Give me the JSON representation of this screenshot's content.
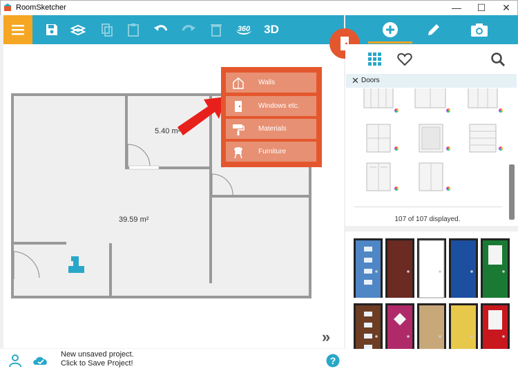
{
  "window": {
    "title": "RoomSketcher",
    "minimize": "—",
    "maximize": "☐",
    "close": "✕"
  },
  "toolbar": {
    "tools": [
      "menu-icon",
      "save-icon",
      "layers-icon",
      "copy-icon",
      "paste-icon",
      "undo-icon",
      "redo-icon",
      "delete-icon",
      "view-360-icon",
      "view-3d-icon"
    ],
    "label_360": "360",
    "label_3d": "3D"
  },
  "plan": {
    "room_small_area": "5.40 m²",
    "room_large_area": "39.59 m²"
  },
  "popup_menu": {
    "items": [
      {
        "label": "Walls",
        "icon": "house-icon"
      },
      {
        "label": "Windows etc.",
        "icon": "door-icon"
      },
      {
        "label": "Materials",
        "icon": "paint-roller-icon"
      },
      {
        "label": "Furniture",
        "icon": "chair-icon"
      }
    ]
  },
  "right_panel": {
    "tabs": [
      "add-icon",
      "edit-icon",
      "camera-icon"
    ],
    "subtabs": [
      "grid-icon",
      "heart-icon",
      "search-icon"
    ],
    "filter_label": "Doors",
    "count_text": "107 of 107 displayed."
  },
  "door_colors": [
    "#4f86c6",
    "#6b2a22",
    "#ffffff",
    "#1d4fa0",
    "#1a7a33",
    "#6d3d24",
    "#b02a6a",
    "#c8a878",
    "#e8c84a",
    "#c8181e"
  ],
  "status": {
    "line1": "New unsaved project.",
    "line2": "Click to Save Project!",
    "help": "?"
  },
  "colors": {
    "accent_blue": "#29a7c8",
    "accent_orange": "#f5a623",
    "popup_red": "#e4572e"
  }
}
